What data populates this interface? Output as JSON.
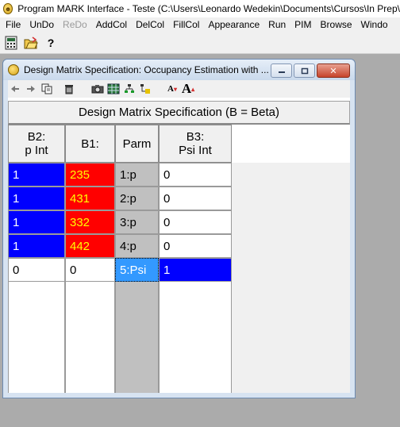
{
  "app": {
    "title": "Program MARK Interface - Teste  (C:\\Users\\Leonardo Wedekin\\Documents\\Cursos\\In Prep\\"
  },
  "menu": [
    "File",
    "UnDo",
    "ReDo",
    "AddCol",
    "DelCol",
    "FillCol",
    "Appearance",
    "Run",
    "PIM",
    "Browse",
    "Windo"
  ],
  "app_toolbar": [
    "calculator-icon",
    "open-folder-icon",
    "help-icon"
  ],
  "window": {
    "title": "Design Matrix Specification: Occupancy Estimation with ...",
    "controls": [
      "minimize",
      "restore",
      "close"
    ]
  },
  "inner_toolbar": [
    "arrow-left-icon",
    "arrow-right-icon",
    "copy-icon",
    "delete-icon",
    "camera-icon",
    "grid-icon",
    "flow-green-icon",
    "flow-yellow-icon",
    "font-smaller-icon",
    "font-larger-icon"
  ],
  "matrix": {
    "title": "Design Matrix Specification (B = Beta)",
    "columns": [
      {
        "line1": "B2:",
        "line2": "p Int"
      },
      {
        "line1": "B1:",
        "line2": ""
      },
      {
        "line1": "Parm",
        "line2": ""
      },
      {
        "line1": "B3:",
        "line2": "Psi Int"
      }
    ],
    "rows": [
      [
        "1",
        "235",
        "1:p",
        "0"
      ],
      [
        "1",
        "431",
        "2:p",
        "0"
      ],
      [
        "1",
        "332",
        "3:p",
        "0"
      ],
      [
        "1",
        "442",
        "4:p",
        "0"
      ],
      [
        "0",
        "0",
        "5:Psi",
        "1"
      ]
    ]
  },
  "colors": {
    "blue": "#0000ff",
    "red": "#ff0000",
    "yellow_text": "#ffff00",
    "parm_gray": "#c0c0c0",
    "selected_parm": "#3399ff"
  }
}
